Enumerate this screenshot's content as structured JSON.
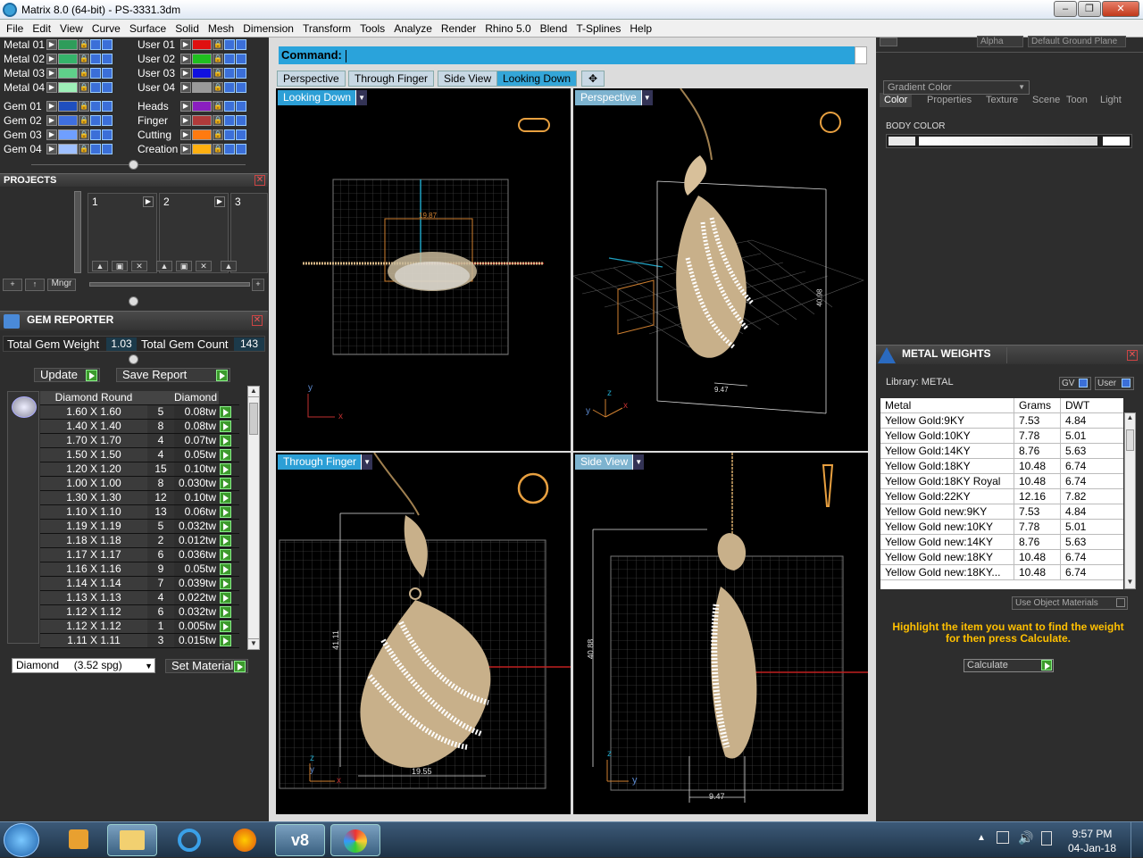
{
  "window": {
    "title": "Matrix 8.0 (64-bit) - PS-3331.3dm"
  },
  "menu": [
    "File",
    "Edit",
    "View",
    "Curve",
    "Surface",
    "Solid",
    "Mesh",
    "Dimension",
    "Transform",
    "Tools",
    "Analyze",
    "Render",
    "Rhino 5.0",
    "Blend",
    "T-Splines",
    "Help"
  ],
  "layers_left": [
    {
      "name": "Metal 01",
      "color": "#2e9c5a"
    },
    {
      "name": "Metal 02",
      "color": "#35b36a"
    },
    {
      "name": "Metal 03",
      "color": "#5fd08a"
    },
    {
      "name": "Metal 04",
      "color": "#9ef0b8"
    },
    {
      "name": "Gem 01",
      "color": "#1f4fbf"
    },
    {
      "name": "Gem 02",
      "color": "#3f6fdf"
    },
    {
      "name": "Gem 03",
      "color": "#6f9fff"
    },
    {
      "name": "Gem 04",
      "color": "#9fc0ff"
    }
  ],
  "layers_right": [
    {
      "name": "User 01",
      "color": "#e01010"
    },
    {
      "name": "User 02",
      "color": "#1fbf1f"
    },
    {
      "name": "User 03",
      "color": "#1010e0"
    },
    {
      "name": "User 04",
      "color": "#9a9a9a"
    },
    {
      "name": "Heads",
      "color": "#8a1fbf"
    },
    {
      "name": "Finger",
      "color": "#b03a3a"
    },
    {
      "name": "Cutting",
      "color": "#ff7a10"
    },
    {
      "name": "Creation",
      "color": "#ffb010"
    }
  ],
  "projects": {
    "title": "PROJECTS",
    "slots": [
      "1",
      "2",
      "3"
    ],
    "mngr": "Mngr"
  },
  "gem_reporter": {
    "title": "GEM REPORTER",
    "weight_label": "Total Gem Weight",
    "weight": "1.03",
    "count_label": "Total Gem Count",
    "count": "143",
    "update": "Update",
    "save": "Save Report",
    "col1": "Diamond Round",
    "col2": "Diamond",
    "rows": [
      [
        "1.60 X 1.60",
        "5",
        "0.08tw"
      ],
      [
        "1.40 X 1.40",
        "8",
        "0.08tw"
      ],
      [
        "1.70 X 1.70",
        "4",
        "0.07tw"
      ],
      [
        "1.50 X 1.50",
        "4",
        "0.05tw"
      ],
      [
        "1.20 X 1.20",
        "15",
        "0.10tw"
      ],
      [
        "1.00 X 1.00",
        "8",
        "0.030tw"
      ],
      [
        "1.30 X 1.30",
        "12",
        "0.10tw"
      ],
      [
        "1.10 X 1.10",
        "13",
        "0.06tw"
      ],
      [
        "1.19 X 1.19",
        "5",
        "0.032tw"
      ],
      [
        "1.18 X 1.18",
        "2",
        "0.012tw"
      ],
      [
        "1.17 X 1.17",
        "6",
        "0.036tw"
      ],
      [
        "1.16 X 1.16",
        "9",
        "0.05tw"
      ],
      [
        "1.14 X 1.14",
        "7",
        "0.039tw"
      ],
      [
        "1.13 X 1.13",
        "4",
        "0.022tw"
      ],
      [
        "1.12 X 1.12",
        "6",
        "0.032tw"
      ],
      [
        "1.12 X 1.12",
        "1",
        "0.005tw"
      ],
      [
        "1.11 X 1.11",
        "3",
        "0.015tw"
      ]
    ],
    "material": "Diamond     (3.52 spg)",
    "set_material": "Set Material"
  },
  "command": {
    "label": "Command:"
  },
  "view_tabs": [
    "Perspective",
    "Through Finger",
    "Side View",
    "Looking Down"
  ],
  "viewports": {
    "top_left": "Looking Down",
    "top_right": "Perspective",
    "bottom_left": "Through Finger",
    "bottom_right": "Side View"
  },
  "dims": {
    "tl": "19.87",
    "tr_h": "40.98",
    "tr_w": "9.47",
    "bl_h": "41.11",
    "bl_w": "19.55",
    "br_h": "40.88",
    "br_w": "9.47"
  },
  "right_panel": {
    "top_fields": [
      "Alpha",
      "Default Ground Plane"
    ],
    "tabs": [
      "Color",
      "Properties",
      "Texture",
      "Scene",
      "Toon",
      "Light"
    ],
    "gradient": "Gradient Color",
    "body_color": "BODY COLOR"
  },
  "metal_weights": {
    "title": "METAL WEIGHTS",
    "library": "Library: METAL",
    "gv": "GV",
    "user": "User",
    "cols": [
      "Metal",
      "Grams",
      "DWT"
    ],
    "rows": [
      [
        "Yellow Gold:9KY",
        "7.53",
        "4.84"
      ],
      [
        "Yellow Gold:10KY",
        "7.78",
        "5.01"
      ],
      [
        "Yellow Gold:14KY",
        "8.76",
        "5.63"
      ],
      [
        "Yellow Gold:18KY",
        "10.48",
        "6.74"
      ],
      [
        "Yellow Gold:18KY Royal",
        "10.48",
        "6.74"
      ],
      [
        "Yellow Gold:22KY",
        "12.16",
        "7.82"
      ],
      [
        "Yellow Gold new:9KY",
        "7.53",
        "4.84"
      ],
      [
        "Yellow Gold new:10KY",
        "7.78",
        "5.01"
      ],
      [
        "Yellow Gold new:14KY",
        "8.76",
        "5.63"
      ],
      [
        "Yellow Gold new:18KY",
        "10.48",
        "6.74"
      ],
      [
        "Yellow Gold new:18KY...",
        "10.48",
        "6.74"
      ]
    ],
    "use_obj": "Use Object Materials",
    "hint": "Highlight the item you want to find the weight for then press Calculate.",
    "calculate": "Calculate"
  },
  "taskbar": {
    "time": "9:57 PM",
    "date": "04-Jan-18"
  }
}
